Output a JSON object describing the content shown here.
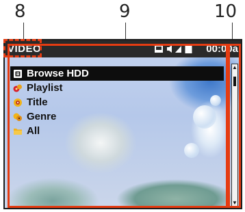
{
  "callouts": {
    "c8": "8",
    "c9": "9",
    "c10": "10"
  },
  "status": {
    "mode_label": "VIDEO",
    "time": "00:00a",
    "icons": [
      "media-card-icon",
      "speaker-icon",
      "volume-level-icon",
      "battery-icon"
    ]
  },
  "menu": {
    "items": [
      {
        "label": "Browse HDD",
        "icon": "hdd-icon",
        "selected": true
      },
      {
        "label": "Playlist",
        "icon": "playlist-icon",
        "selected": false
      },
      {
        "label": "Title",
        "icon": "title-icon",
        "selected": false
      },
      {
        "label": "Genre",
        "icon": "genre-icon",
        "selected": false
      },
      {
        "label": "All",
        "icon": "folder-icon",
        "selected": false
      }
    ]
  },
  "colors": {
    "highlight": "#e53c12",
    "statusbar": "#2a2a2a",
    "selection": "#0d0d0d"
  }
}
